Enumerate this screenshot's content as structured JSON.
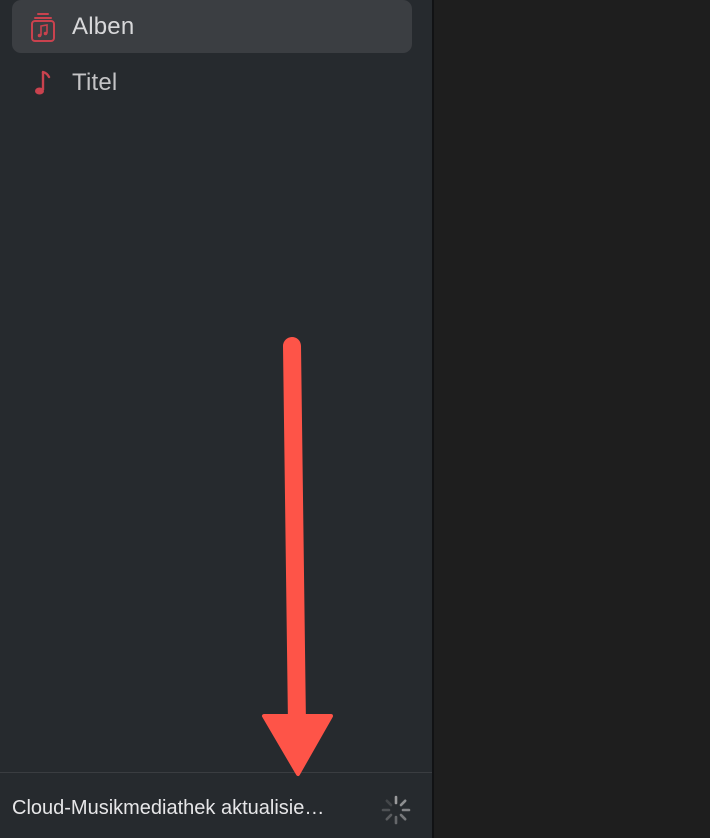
{
  "sidebar": {
    "items": [
      {
        "label": "Alben",
        "icon": "album-stack-icon",
        "selected": true
      },
      {
        "label": "Titel",
        "icon": "music-note-icon",
        "selected": false
      }
    ]
  },
  "status": {
    "text": "Cloud-Musikmediathek aktualisie…",
    "indicator": "spinner-icon"
  },
  "colors": {
    "accent_icon": "#c9424e",
    "annotation_arrow": "#fe5448",
    "sidebar_bg": "#262a2e",
    "selected_bg": "#3b3e42",
    "content_bg": "#1e1e1e"
  }
}
